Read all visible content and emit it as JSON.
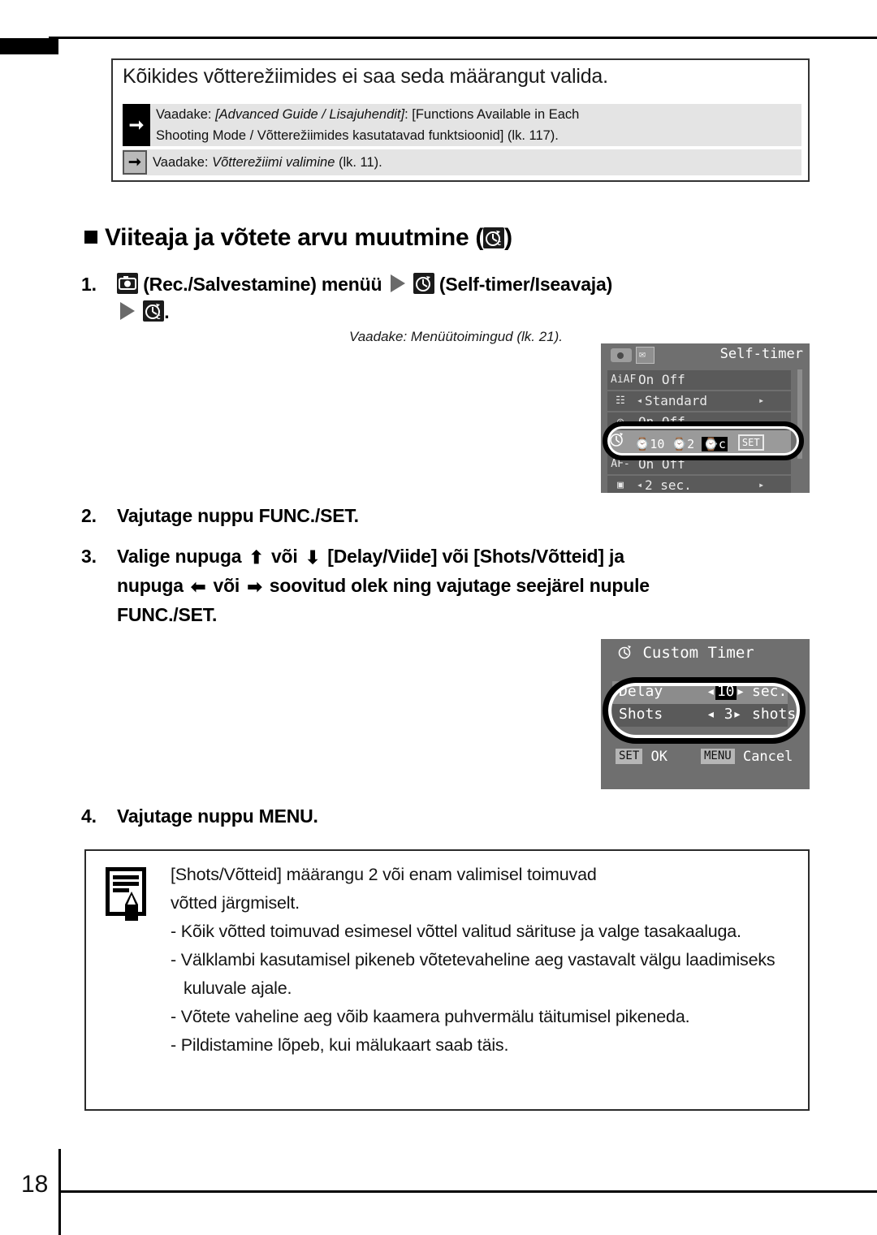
{
  "page": {
    "number": "18"
  },
  "caution": {
    "title": "Kõikides võtterežiimides ei saa seda määrangut valida.",
    "references": [
      {
        "icon": "arrow-right-icon",
        "style": "solid",
        "line1_prefix": "Vaadake: ",
        "line1_italic": "[Advanced Guide / Lisajuhendit]",
        "line1_suffix": ": [Functions Available in Each",
        "line2": "Shooting Mode / Võtterežiimides kasutatavad funktsioonid] (lk. 117)."
      },
      {
        "icon": "arrow-right-icon",
        "style": "outline",
        "line1_prefix": "Vaadake: ",
        "line1_italic": "Võtterežiimi valimine",
        "line1_suffix": " (lk. 11)."
      }
    ]
  },
  "section": {
    "heading_text": "Viiteaja ja võtete arvu muutmine (",
    "heading_icon": "custom-timer-icon",
    "heading_close": ")"
  },
  "steps": [
    {
      "num": "1.",
      "icon1": "rec-camera-icon",
      "part1": "(Rec./Salvestamine) menüü",
      "icon2": "triangle-right-icon",
      "icon3": "self-timer-icon",
      "part2": "(Self-timer/Iseavaja)",
      "icon4": "triangle-right-icon",
      "icon5": "custom-timer-icon",
      "part3": "."
    },
    {
      "num": "2.",
      "text": "Vajutage nuppu FUNC./SET."
    },
    {
      "num": "3.",
      "t1": "Valige nupuga",
      "i1": "arrow-up-icon",
      "t2": "või",
      "i2": "arrow-down-icon",
      "t3": "[Delay/Viide] või [Shots/Võtteid] ja",
      "t4": "nupuga",
      "i3": "arrow-left-icon",
      "t5": "või",
      "i4": "arrow-right-icon",
      "t6": "soovitud olek ning vajutage seejärel nupule",
      "t7": "FUNC./SET."
    },
    {
      "num": "4.",
      "text": "Vajutage nuppu MENU."
    }
  ],
  "menu_op_reference": "Vaadake: Menüütoimingud (lk. 21).",
  "lcd_selftimer": {
    "title": "Self-timer",
    "tab_icons": [
      "camera-tab-icon",
      "wrench-tab-icon"
    ],
    "rows": [
      {
        "icon": "AiAF",
        "value": "On  Off"
      },
      {
        "icon": "af-frame-icon",
        "value": "Standard",
        "left_arrow": "◂",
        "right_arrow": "▸"
      },
      {
        "icon": "digital-zoom-icon",
        "value": "On  Off"
      },
      {
        "icon": "self-timer-icon",
        "value": "10  2",
        "options": [
          "Ci10",
          "Ci2",
          "Cc"
        ],
        "set_label": "SET",
        "highlighted": true
      },
      {
        "icon": "AF-assist",
        "value": "On  Off"
      },
      {
        "icon": "review-icon",
        "value": "2 sec.",
        "left_arrow": "◂",
        "right_arrow": "▸"
      }
    ]
  },
  "lcd_custom_timer": {
    "title": "Custom Timer",
    "title_icon": "self-timer-icon",
    "rows": [
      {
        "label": "Delay",
        "left_arrow": "◂",
        "value": "10",
        "right_arrow": "▸",
        "unit": "sec.",
        "selected": true
      },
      {
        "label": "Shots",
        "left_arrow": "◂",
        "value": "3",
        "right_arrow": "▸",
        "unit": "shots",
        "selected": false
      }
    ],
    "footer": {
      "set_key": "SET",
      "set_label": "OK",
      "menu_key": "MENU",
      "menu_label": "Cancel"
    }
  },
  "note": {
    "icon": "memo-pencil-icon",
    "intro_line1": "[Shots/Võtteid] määrangu 2 või enam valimisel toimuvad",
    "intro_line2": "võtted järgmiselt.",
    "bullets": [
      "- Kõik võtted toimuvad esimesel võttel valitud särituse ja  valge tasakaaluga.",
      "- Välklambi kasutamisel pikeneb võtetevaheline aeg  vastavalt välgu laadimiseks kuluvale ajale.",
      "- Võtete vaheline aeg võib kaamera puhvermälu täitumisel  pikeneda.",
      "- Pildistamine lõpeb, kui mälukaart saab täis."
    ]
  },
  "colors": {
    "lcd_background": "#6f6f6f",
    "lcd_row": "#5a5a5a",
    "lcd_row_highlight": "#9a9a9a",
    "reference_band": "#e4e4e4",
    "rule": "#000000"
  }
}
